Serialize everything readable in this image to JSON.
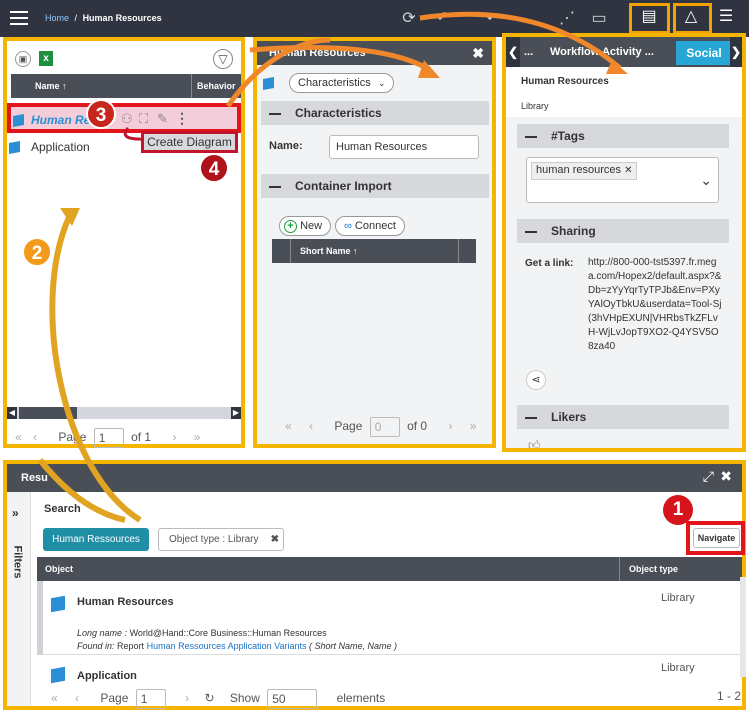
{
  "topbar": {
    "home": "Home",
    "sep": "/",
    "title": "Human Resources"
  },
  "left": {
    "col_name": "Name ↑",
    "col_behavior": "Behavior",
    "rows": [
      {
        "label": "Human Res"
      },
      {
        "label": "Application"
      }
    ],
    "pager": {
      "page_label": "Page",
      "page": "1",
      "of": "of 1"
    }
  },
  "tooltip": "Create Diagram",
  "badges": {
    "one": "1",
    "two": "2",
    "three": "3",
    "four": "4"
  },
  "middle": {
    "title": "Human Resources",
    "view_select": "Characteristics",
    "section_characteristics": "Characteristics",
    "name_label": "Name:",
    "name_value": "Human Resources",
    "section_import": "Container Import",
    "new_label": "New",
    "connect_label": "Connect",
    "col_short_name": "Short Name ↑",
    "pager": {
      "page_label": "Page",
      "page": "0",
      "of": "of 0"
    }
  },
  "right": {
    "tab_left": "...",
    "tab_workflow": "Workflow Activity ...",
    "tab_social": "Social",
    "obj_title": "Human Resources",
    "obj_type": "Library",
    "section_tags": "#Tags",
    "tag": "human resources",
    "section_sharing": "Sharing",
    "getlink_label": "Get a link:",
    "link": "http://800-000-tst5397.fr.mega.com/Hopex2/default.aspx?&Db=zYyYqrTyTPJb&Env=PXyYAlOyTbkU&userdata=Tool-Sj(3hVHpEXUN|VHRbsTkZFLvH-WjLvJopT9XO2-Q4YSV5O8za40",
    "section_likers": "Likers"
  },
  "bottom": {
    "title": "Resu",
    "filters": "Filters",
    "search_label": "Search",
    "chip_hr": "Human Ressources",
    "chip_type": "Object type : Library",
    "navigate": "Navigate",
    "col_object": "Object",
    "col_type": "Object type",
    "rows": [
      {
        "name": "Human Resources",
        "type": "Library",
        "longname_label": "Long name :",
        "longname": "World@Hand::Core Business::Human Resources",
        "found_label": "Found in:",
        "found_prefix": "Report",
        "found_link": "Human Ressources Application Variants",
        "found_suffix": "( Short Name, Name )"
      },
      {
        "name": "Application",
        "type": "Library"
      }
    ],
    "pager": {
      "page_label": "Page",
      "page": "1",
      "show": "Show",
      "count": "50",
      "elements": "elements",
      "range": "1 - 2"
    }
  },
  "colors": {
    "accent_orange": "#f4a200",
    "highlight_red": "#e3151a",
    "header_dark": "#4a4f57",
    "social_tab": "#28a6d6",
    "chip_teal": "#1f8fa6"
  }
}
